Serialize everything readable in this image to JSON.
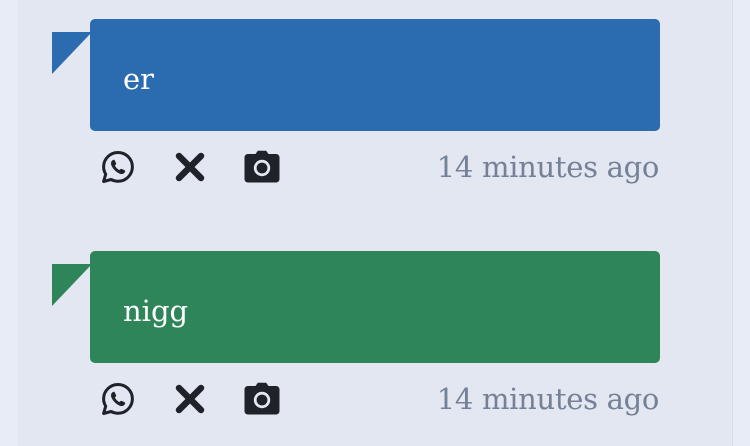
{
  "messages": [
    {
      "text": "er",
      "color": "#2b6cb0",
      "timestamp": "14 minutes ago",
      "actions": [
        "whatsapp-icon",
        "close-icon",
        "camera-icon"
      ]
    },
    {
      "text": "nigg",
      "color": "#2f855a",
      "timestamp": "14 minutes ago",
      "actions": [
        "whatsapp-icon",
        "close-icon",
        "camera-icon"
      ]
    }
  ],
  "colors": {
    "background": "#e2e7f1",
    "icon": "#1f2329",
    "timestamp": "#748196"
  }
}
